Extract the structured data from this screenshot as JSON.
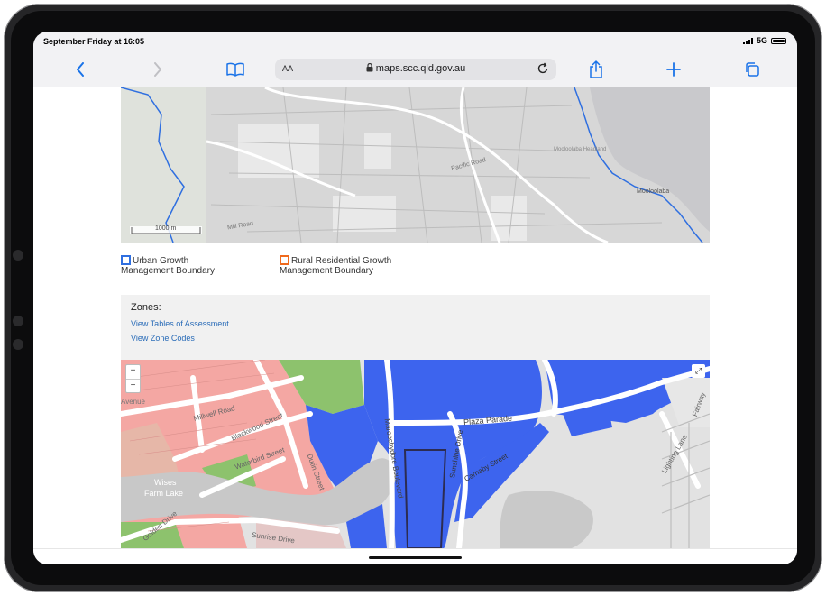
{
  "status": {
    "time": "September Friday at 16:05",
    "network": "5G"
  },
  "browser": {
    "text_size_label": "AA",
    "url": "maps.scc.qld.gov.au",
    "icons": [
      "back-chevron-icon",
      "forward-chevron-icon",
      "bookmarks-book-icon",
      "lock-icon",
      "reload-icon",
      "share-icon",
      "new-tab-plus-icon",
      "tabs-icon"
    ]
  },
  "map_top": {
    "scale_label": "1000 m",
    "labels": [
      "Mill Road",
      "Pacific Road",
      "Mooloolaba",
      "Mooloolaba Headland"
    ],
    "boundary_color": "#2f6fe0"
  },
  "legend": {
    "urban_line1": "Urban Growth",
    "urban_line2": "Management Boundary",
    "urban_color": "#2f6fe0",
    "rural_line1": "Rural Residential Growth",
    "rural_line2": "Management Boundary",
    "rural_color": "#f06a1d"
  },
  "zones": {
    "title": "Zones:",
    "link_tables": "View Tables of Assessment",
    "link_codes": "View Zone Codes"
  },
  "map_bottom": {
    "zoom_in": "+",
    "zoom_out": "−",
    "fullscreen": "⤢",
    "street_labels": {
      "millwell": "Millwell Road",
      "blackwood": "Blackwood Street",
      "waterbird": "Waterbird Street",
      "dutin": "Dutin Street",
      "wises1": "Wises",
      "wises2": "Farm Lake",
      "sunrise": "Sunrise Drive",
      "golden": "Golden Drive",
      "maroochydore": "Maroochydore Boulevard",
      "plaza": "Plaza Parade",
      "sunshine": "Sunshine Drive",
      "carnaby": "Carnaby Street",
      "lighting": "Lighting Lane",
      "fairway": "Fairway",
      "avenue": "Avenue"
    },
    "zone_colors": {
      "residential": "#f4a7a3",
      "centre": "#3d64ee",
      "open_space": "#8dc26d",
      "water": "#c8c8c8"
    }
  }
}
